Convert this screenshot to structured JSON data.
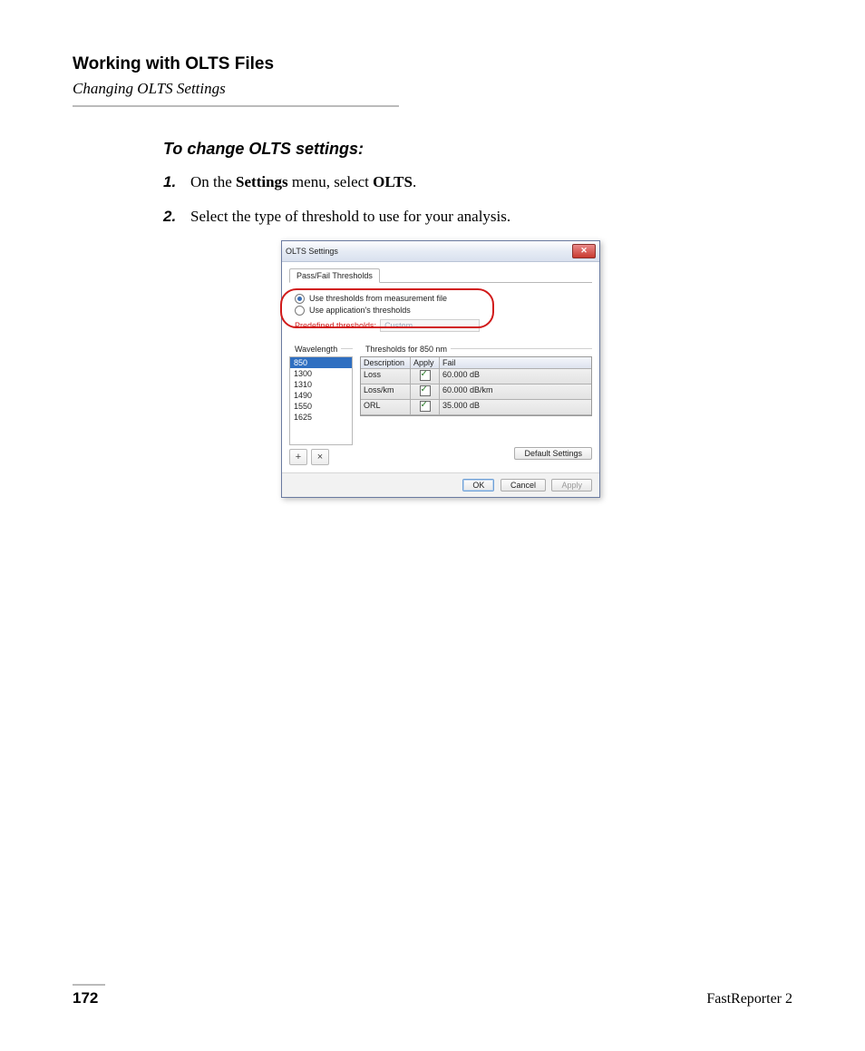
{
  "header": {
    "title": "Working with OLTS Files",
    "subtitle": "Changing OLTS Settings"
  },
  "procedure": {
    "title": "To change OLTS settings:",
    "steps": [
      {
        "num": "1.",
        "pre": "On the ",
        "b1": "Settings",
        "mid": " menu, select ",
        "b2": "OLTS",
        "post": "."
      },
      {
        "num": "2.",
        "plain": "Select the type of threshold to use for your analysis."
      }
    ]
  },
  "dialog": {
    "title": "OLTS Settings",
    "tab": "Pass/Fail Thresholds",
    "radio1": "Use thresholds from measurement file",
    "radio2": "Use application's thresholds",
    "predef_label": "Predefined thresholds:",
    "predef_value": "Custom",
    "wave_label": "Wavelength",
    "wavelengths": [
      "850",
      "1300",
      "1310",
      "1490",
      "1550",
      "1625"
    ],
    "thr_label": "Thresholds for 850 nm",
    "grid_headers": [
      "Description",
      "Apply",
      "Fail"
    ],
    "grid_rows": [
      {
        "desc": "Loss",
        "fail": "60.000 dB"
      },
      {
        "desc": "Loss/km",
        "fail": "60.000 dB/km"
      },
      {
        "desc": "ORL",
        "fail": "35.000 dB"
      }
    ],
    "default_btn": "Default Settings",
    "ok": "OK",
    "cancel": "Cancel",
    "apply": "Apply"
  },
  "footer": {
    "page": "172",
    "product": "FastReporter 2"
  }
}
